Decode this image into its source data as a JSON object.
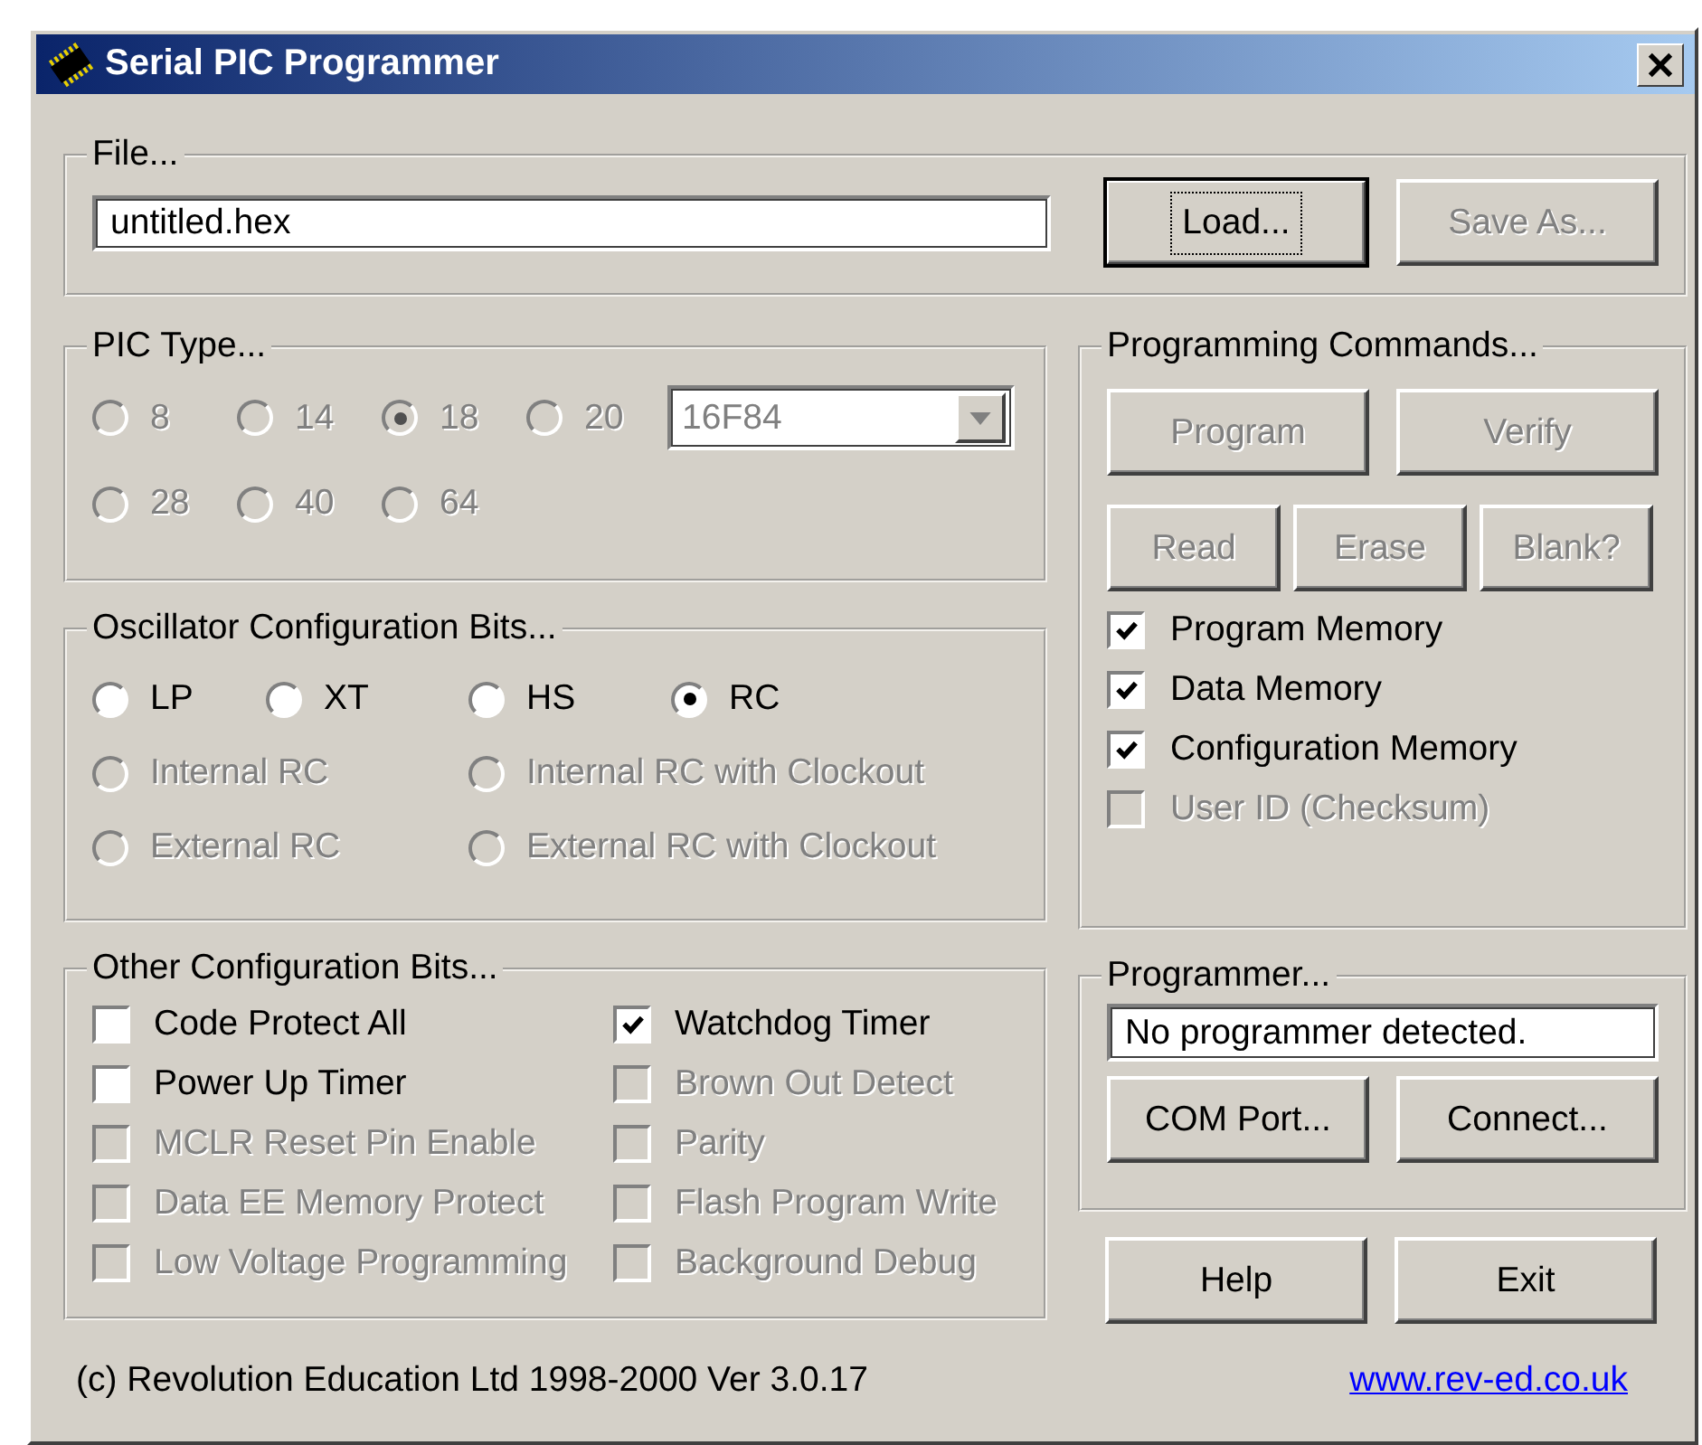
{
  "window": {
    "title": "Serial PIC Programmer"
  },
  "file": {
    "legend": "File...",
    "value": "untitled.hex",
    "buttons": [
      {
        "label": "Load...",
        "disabled": false,
        "focused": true
      },
      {
        "label": "Save As...",
        "disabled": true,
        "focused": false
      }
    ]
  },
  "pic_type": {
    "legend": "PIC Type...",
    "rows": [
      [
        {
          "label": "8",
          "selected": false,
          "disabled": true
        },
        {
          "label": "14",
          "selected": false,
          "disabled": true
        },
        {
          "label": "18",
          "selected": true,
          "disabled": true
        },
        {
          "label": "20",
          "selected": false,
          "disabled": true
        }
      ],
      [
        {
          "label": "28",
          "selected": false,
          "disabled": true
        },
        {
          "label": "40",
          "selected": false,
          "disabled": true
        },
        {
          "label": "64",
          "selected": false,
          "disabled": true
        }
      ]
    ],
    "dropdown": {
      "value": "16F84",
      "disabled": true
    }
  },
  "oscillator": {
    "legend": "Oscillator Configuration Bits...",
    "rows": [
      [
        {
          "label": "LP",
          "selected": false,
          "disabled": false
        },
        {
          "label": "XT",
          "selected": false,
          "disabled": false
        },
        {
          "label": "HS",
          "selected": false,
          "disabled": false
        },
        {
          "label": "RC",
          "selected": true,
          "disabled": false
        }
      ],
      [
        {
          "label": "Internal RC",
          "selected": false,
          "disabled": true
        },
        {
          "label": "Internal RC with Clockout",
          "selected": false,
          "disabled": true
        }
      ],
      [
        {
          "label": "External RC",
          "selected": false,
          "disabled": true
        },
        {
          "label": "External RC with Clockout",
          "selected": false,
          "disabled": true
        }
      ]
    ]
  },
  "other_bits": {
    "legend": "Other Configuration Bits...",
    "checks": [
      {
        "label": "Code Protect All",
        "checked": false,
        "disabled": false
      },
      {
        "label": "Watchdog Timer",
        "checked": true,
        "disabled": false
      },
      {
        "label": "Power Up Timer",
        "checked": false,
        "disabled": false
      },
      {
        "label": "Brown Out Detect",
        "checked": false,
        "disabled": true
      },
      {
        "label": "MCLR Reset Pin Enable",
        "checked": false,
        "disabled": true
      },
      {
        "label": "Parity",
        "checked": false,
        "disabled": true
      },
      {
        "label": "Data EE Memory Protect",
        "checked": false,
        "disabled": true
      },
      {
        "label": "Flash Program Write",
        "checked": false,
        "disabled": true
      },
      {
        "label": "Low Voltage Programming",
        "checked": false,
        "disabled": true
      },
      {
        "label": "Background Debug",
        "checked": false,
        "disabled": true
      }
    ]
  },
  "commands": {
    "legend": "Programming Commands...",
    "button_rows": [
      [
        {
          "label": "Program",
          "disabled": true
        },
        {
          "label": "Verify",
          "disabled": true
        }
      ],
      [
        {
          "label": "Read",
          "disabled": true
        },
        {
          "label": "Erase",
          "disabled": true
        },
        {
          "label": "Blank?",
          "disabled": true
        }
      ]
    ],
    "checks": [
      {
        "label": "Program Memory",
        "checked": true,
        "disabled": false
      },
      {
        "label": "Data Memory",
        "checked": true,
        "disabled": false
      },
      {
        "label": "Configuration Memory",
        "checked": true,
        "disabled": false
      },
      {
        "label": "User ID (Checksum)",
        "checked": false,
        "disabled": true
      }
    ]
  },
  "programmer": {
    "legend": "Programmer...",
    "status": "No programmer detected.",
    "buttons": [
      {
        "label": "COM Port...",
        "disabled": false
      },
      {
        "label": "Connect...",
        "disabled": false
      }
    ]
  },
  "buttons": [
    {
      "label": "Help",
      "disabled": false
    },
    {
      "label": "Exit",
      "disabled": false
    }
  ],
  "footer": {
    "copyright": "(c) Revolution Education Ltd 1998-2000  Ver 3.0.17",
    "link": "www.rev-ed.co.uk"
  }
}
